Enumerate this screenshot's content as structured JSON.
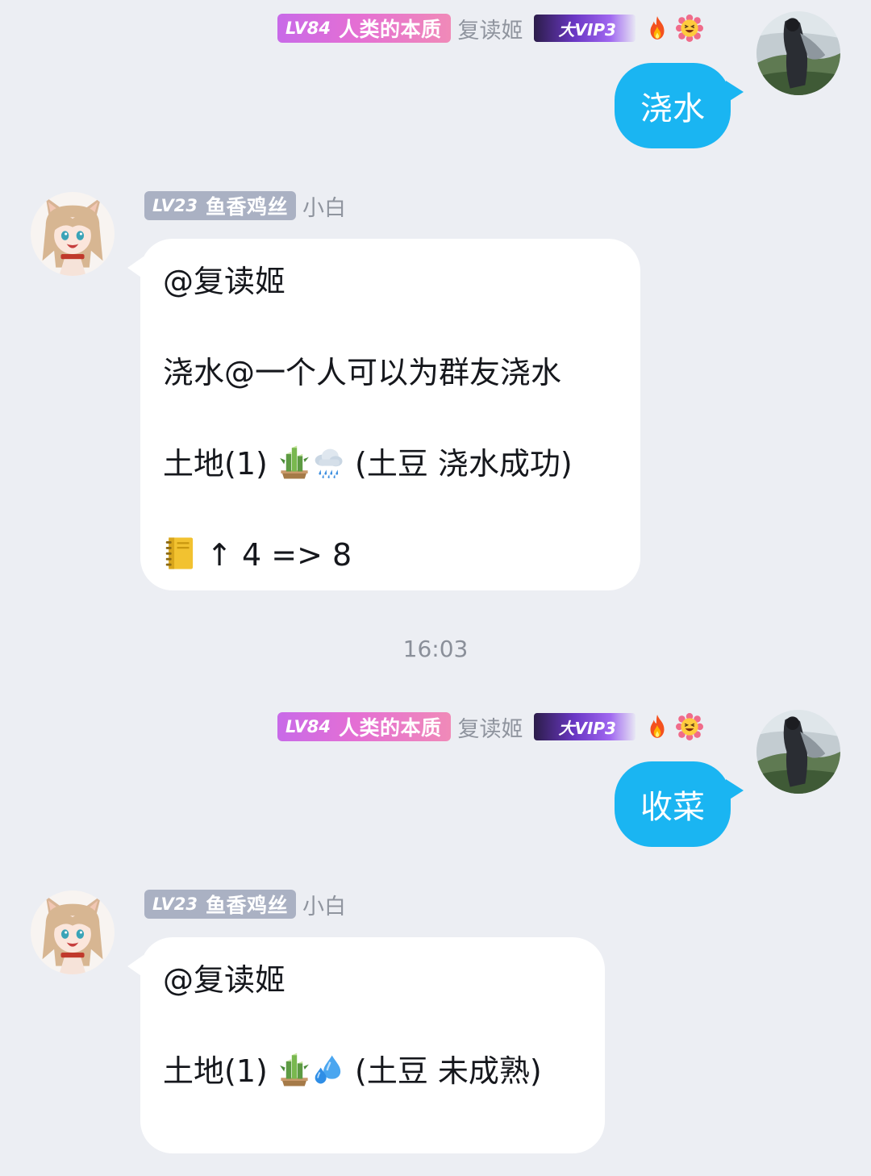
{
  "messages": [
    {
      "type": "outgoing",
      "level": "LV84",
      "title": "人类的本质",
      "nickname": "复读姬",
      "vip": "大VIP3",
      "text": "浇水"
    },
    {
      "type": "incoming",
      "level": "LV23",
      "title": "鱼香鸡丝",
      "nickname": "小白",
      "lines": [
        "@复读姬",
        "浇水@一个人可以为群友浇水",
        {
          "prefix": "土地(1) ",
          "emoji1": "bamboo-sprout-icon",
          "emoji2": "rain-cloud-icon",
          "suffix": " (土豆 浇水成功)"
        },
        {
          "emoji": "notebook-icon",
          "suffix": " ↑ 4 => 8"
        }
      ]
    },
    {
      "type": "timestamp",
      "text": "16:03"
    },
    {
      "type": "outgoing",
      "level": "LV84",
      "title": "人类的本质",
      "nickname": "复读姬",
      "vip": "大VIP3",
      "text": "收菜"
    },
    {
      "type": "incoming",
      "level": "LV23",
      "title": "鱼香鸡丝",
      "nickname": "小白",
      "lines": [
        "@复读姬",
        {
          "prefix": "土地(1) ",
          "emoji1": "bamboo-sprout-icon",
          "emoji2": "sweat-droplets-icon",
          "suffix": " (土豆 未成熟)"
        }
      ]
    }
  ],
  "colors": {
    "background": "#eceef3",
    "outgoing_bubble": "#1ab5f2",
    "incoming_bubble": "#ffffff",
    "level_badge_pink": "#e46fd4",
    "level_badge_gray": "#aab1c3",
    "nickname": "#8f949e"
  }
}
